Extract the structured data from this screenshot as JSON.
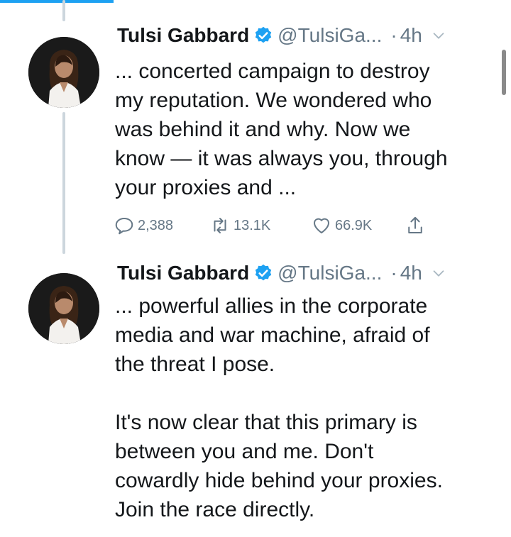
{
  "tweets": [
    {
      "author_name": "Tulsi Gabbard",
      "handle": "@TulsiGa...",
      "separator": "·",
      "time": "4h",
      "text": "... concerted campaign to destroy\nmy reputation. We wondered who\nwas behind it and why. Now we\nknow — it was always you, through\nyour proxies and ...",
      "replies": "2,388",
      "retweets": "13.1K",
      "likes": "66.9K"
    },
    {
      "author_name": "Tulsi Gabbard",
      "handle": "@TulsiGa...",
      "separator": "·",
      "time": "4h",
      "text": "... powerful allies in the corporate\nmedia and war machine, afraid of\nthe threat I pose.\n\nIt's now clear that this primary is\nbetween you and me. Don't\ncowardly hide behind your proxies.\nJoin the race directly."
    }
  ],
  "icons": {
    "verified": "verified-badge-icon",
    "caret": "chevron-down-icon",
    "reply": "reply-icon",
    "retweet": "retweet-icon",
    "like": "heart-icon",
    "share": "share-icon"
  },
  "colors": {
    "accent": "#1da1f2",
    "text": "#14171a",
    "muted": "#657786",
    "thread_line": "#ccd6dd"
  }
}
